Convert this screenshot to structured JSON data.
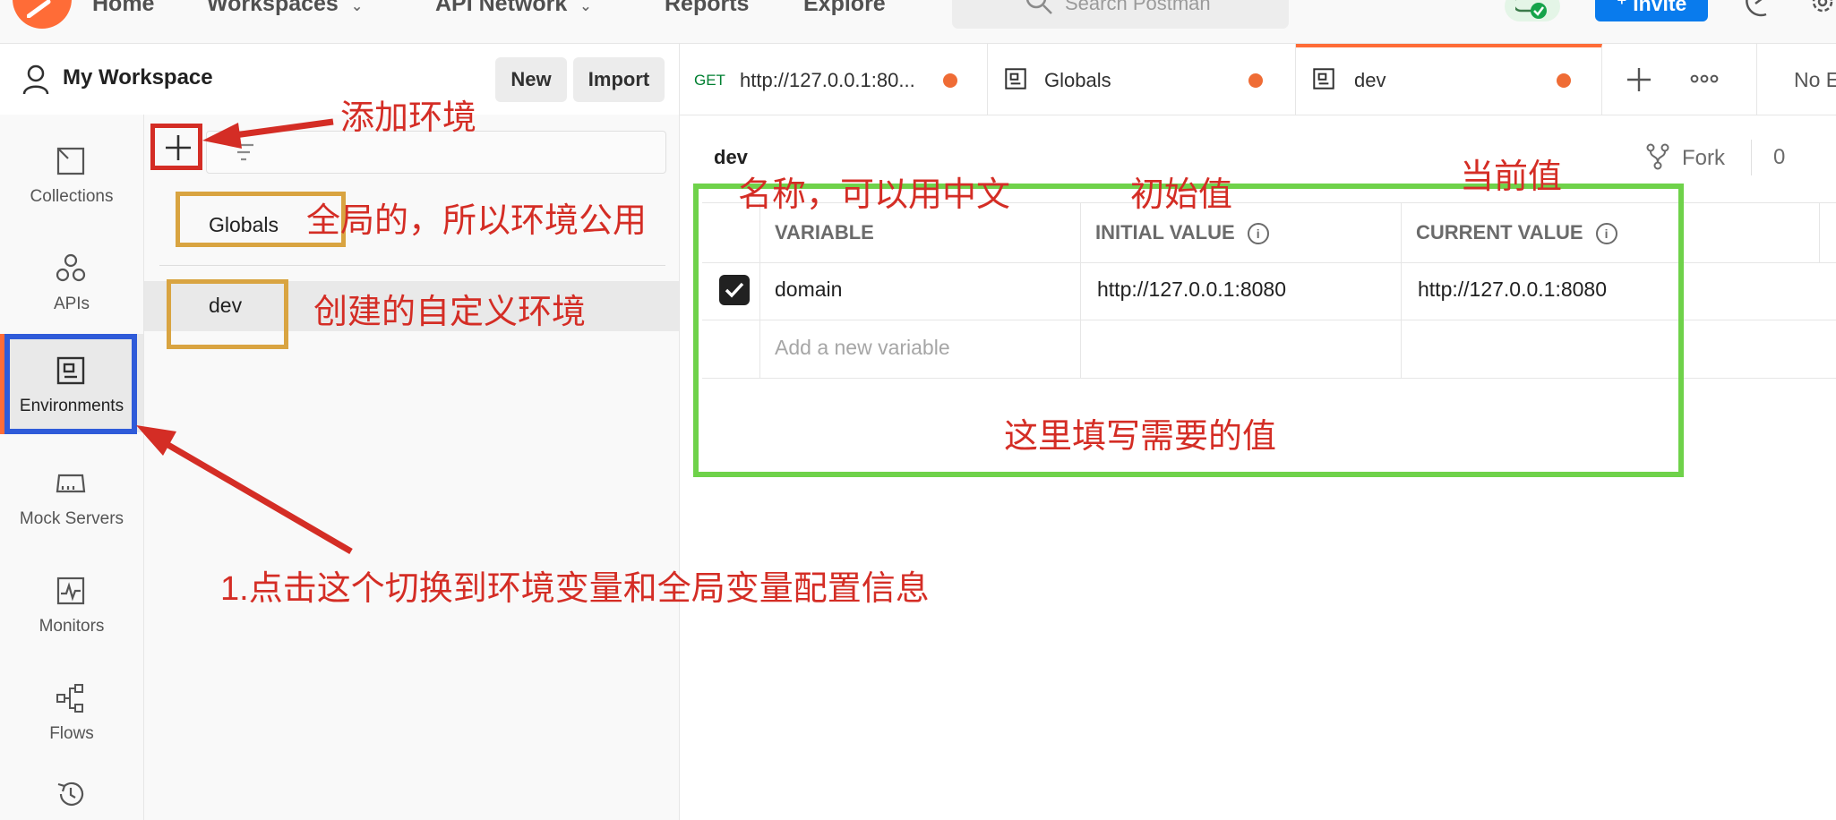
{
  "topbar": {
    "nav": [
      {
        "label": "Home"
      },
      {
        "label": "Workspaces"
      },
      {
        "label": "API Network"
      },
      {
        "label": "Reports"
      },
      {
        "label": "Explore"
      }
    ],
    "search_placeholder": "Search Postman",
    "invite_label": "Invite"
  },
  "workspace": {
    "title": "My Workspace",
    "new_label": "New",
    "import_label": "Import"
  },
  "sidebar": {
    "items": [
      {
        "label": "Collections"
      },
      {
        "label": "APIs"
      },
      {
        "label": "Environments"
      },
      {
        "label": "Mock Servers"
      },
      {
        "label": "Monitors"
      },
      {
        "label": "Flows"
      }
    ]
  },
  "environments": [
    {
      "name": "Globals"
    },
    {
      "name": "dev"
    }
  ],
  "tabs": [
    {
      "method": "GET",
      "title": "http://127.0.0.1:80...",
      "unsaved": true
    },
    {
      "title": "Globals",
      "unsaved": true
    },
    {
      "title": "dev",
      "unsaved": true,
      "active": true
    }
  ],
  "tabs_overflow": "No E",
  "editor": {
    "env_name": "dev",
    "fork_label": "Fork",
    "fork_count": "0",
    "headers": [
      "VARIABLE",
      "INITIAL VALUE",
      "CURRENT VALUE"
    ],
    "rows": [
      {
        "enabled": true,
        "variable": "domain",
        "initial": "http://127.0.0.1:8080",
        "current": "http://127.0.0.1:8080"
      }
    ],
    "add_placeholder": "Add a new variable"
  },
  "annotations": {
    "add_env": "添加环境",
    "globals_note": "全局的，所以环境公用",
    "dev_note": "创建的自定义环境",
    "name_note": "名称，可以用中文",
    "initial_note": "初始值",
    "current_note": "当前值",
    "fill_note": "这里填写需要的值",
    "step_note": "1.点击这个切换到环境变量和全局变量配置信息"
  },
  "colors": {
    "brand": "#ff6c37",
    "annotation_red": "#d42d25",
    "annotation_blue": "#2f5bd9",
    "annotation_gold": "#d9a441",
    "annotation_green": "#6fd24a"
  }
}
